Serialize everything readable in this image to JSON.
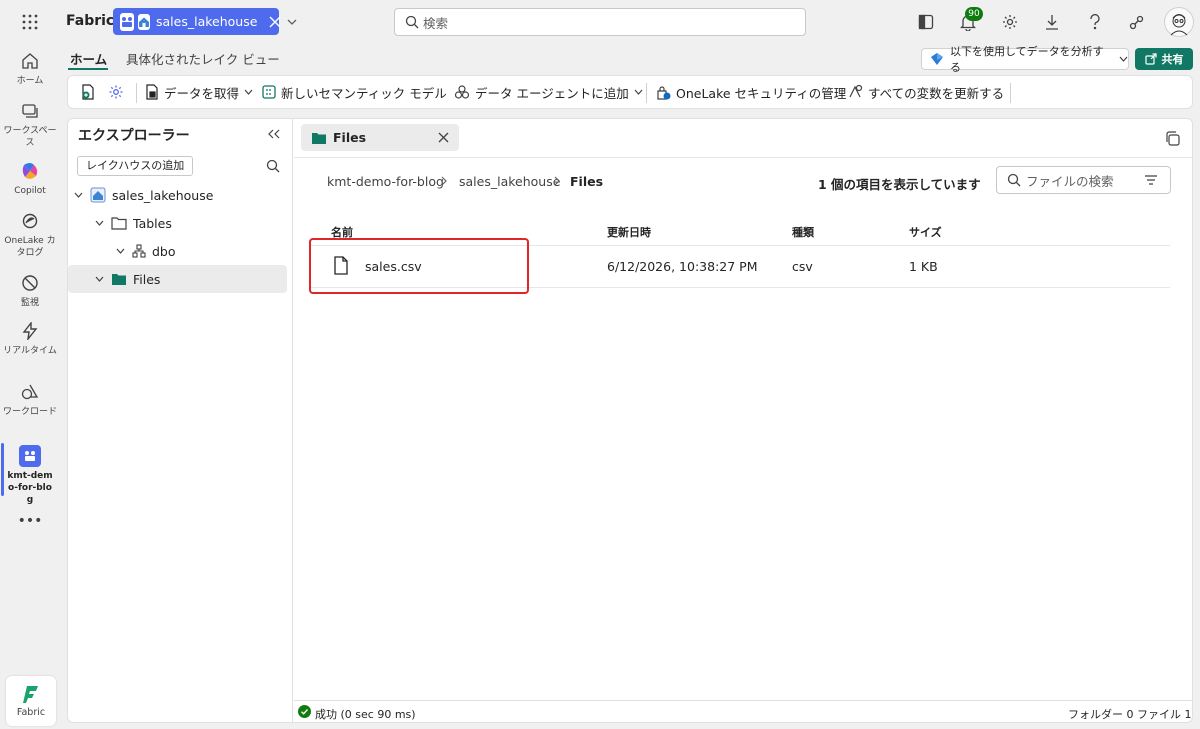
{
  "topbar": {
    "brand": "Fabric",
    "workspace_pill": "sales_lakehouse",
    "search_placeholder": "検索",
    "notification_count": "90"
  },
  "rail": {
    "items": [
      {
        "label": "ホーム",
        "icon": "home-icon"
      },
      {
        "label": "ワークスペース",
        "icon": "workspaces-icon"
      },
      {
        "label": "Copilot",
        "icon": "copilot-icon"
      },
      {
        "label": "OneLake カタログ",
        "icon": "onelake-catalog-icon"
      },
      {
        "label": "監視",
        "icon": "monitor-icon"
      },
      {
        "label": "リアルタイム",
        "icon": "realtime-icon"
      },
      {
        "label": "ワークロード",
        "icon": "workloads-icon"
      },
      {
        "label": "kmt-demo-for-blog",
        "icon": "workspace-icon"
      }
    ],
    "more": "•••",
    "bottom_label": "Fabric"
  },
  "ribbon": {
    "tabs": [
      "ホーム",
      "具体化されたレイク ビュー"
    ],
    "analyze_button": "以下を使用してデータを分析する",
    "share_button": "共有",
    "toolbar": {
      "get_data": "データを取得",
      "new_semantic_model": "新しいセマンティック モデル",
      "add_to_data_agent": "データ エージェントに追加",
      "onelake_security": "OneLake セキュリティの管理",
      "refresh_all_variables": "すべての変数を更新する"
    }
  },
  "explorer": {
    "title": "エクスプローラー",
    "add_lakehouse": "レイクハウスの追加",
    "tree": {
      "root": "sales_lakehouse",
      "tables": "Tables",
      "dbo": "dbo",
      "files": "Files"
    }
  },
  "main": {
    "tab_label": "Files",
    "breadcrumb": [
      "kmt-demo-for-blog",
      "sales_lakehouse",
      "Files"
    ],
    "item_count_text": "1 個の項目を表示しています",
    "file_search_placeholder": "ファイルの検索",
    "table": {
      "columns": [
        "名前",
        "更新日時",
        "種類",
        "サイズ"
      ],
      "rows": [
        {
          "name": "sales.csv",
          "modified": "6/12/2026, 10:38:27 PM",
          "type": "csv",
          "size": "1 KB"
        }
      ]
    }
  },
  "statusbar": {
    "status": "成功 (0 sec 90 ms)",
    "summary": "フォルダー 0 ファイル 1"
  },
  "colors": {
    "accent_green": "#117865",
    "workspace_blue": "#4f6bed",
    "highlight_red": "#e0262b"
  }
}
